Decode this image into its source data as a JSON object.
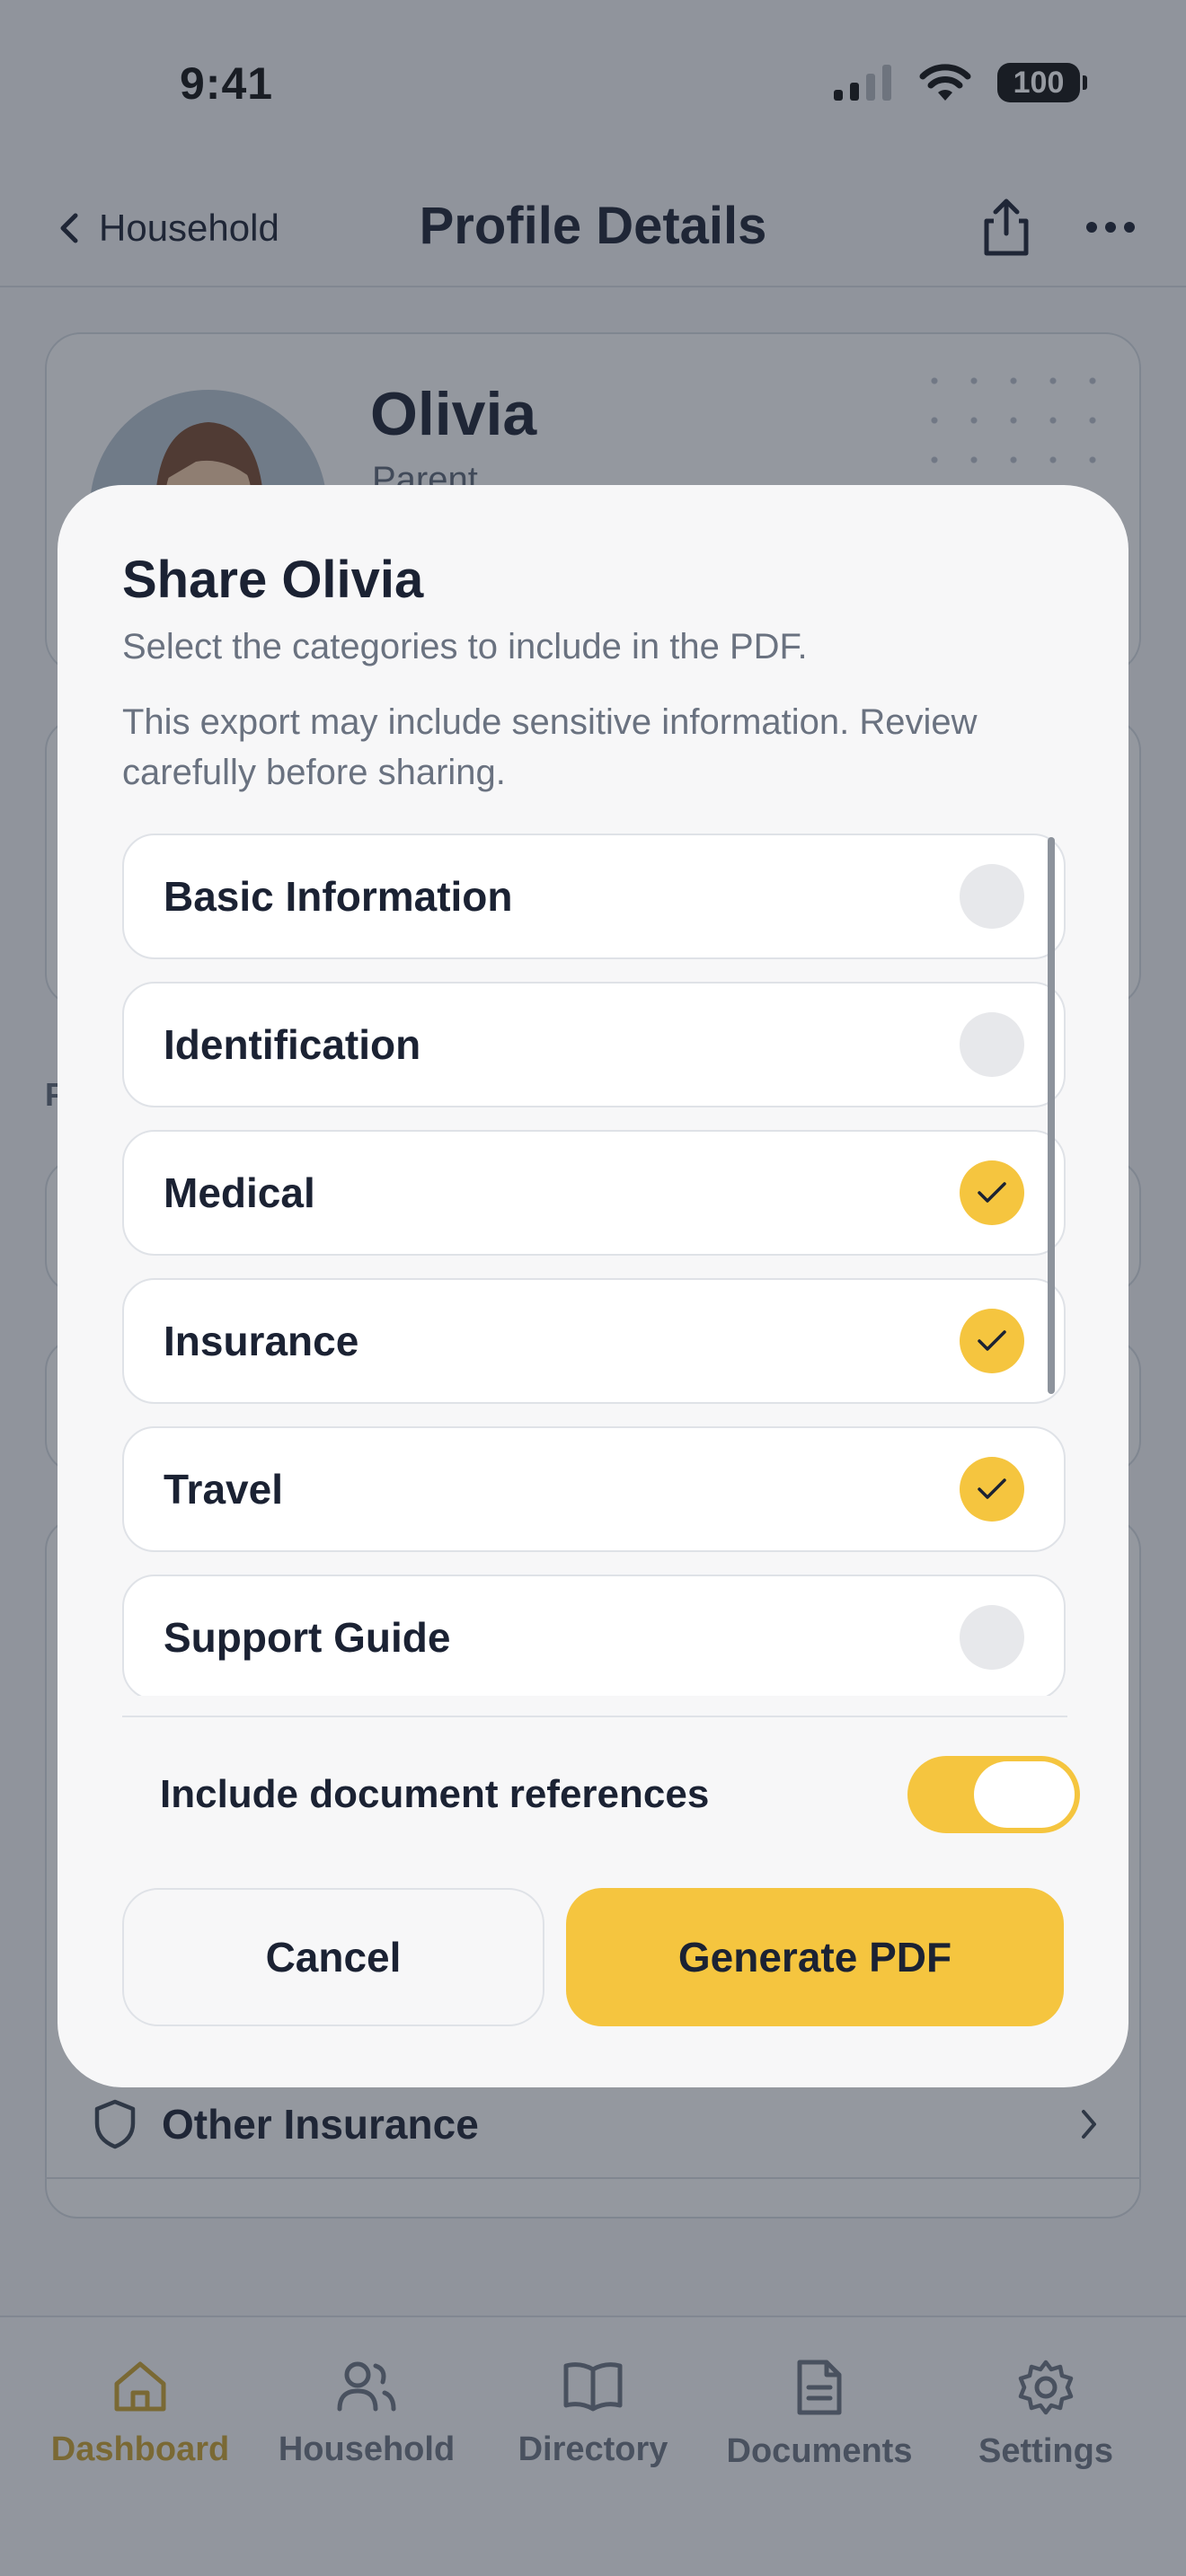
{
  "status_bar": {
    "time": "9:41",
    "battery": "100"
  },
  "nav": {
    "back_label": "Household",
    "title": "Profile Details"
  },
  "profile": {
    "name": "Olivia",
    "role": "Parent"
  },
  "background": {
    "section_initial": "F",
    "row_label": "Other Insurance"
  },
  "modal": {
    "title": "Share Olivia",
    "subtitle": "Select the categories to include in the PDF.",
    "warning": "This export may include sensitive information. Review carefully before sharing.",
    "categories": [
      {
        "label": "Basic Information",
        "checked": false
      },
      {
        "label": "Identification",
        "checked": false
      },
      {
        "label": "Medical",
        "checked": true
      },
      {
        "label": "Insurance",
        "checked": true
      },
      {
        "label": "Travel",
        "checked": true
      },
      {
        "label": "Support Guide",
        "checked": false
      }
    ],
    "toggle_label": "Include document references",
    "toggle_on": true,
    "cancel_label": "Cancel",
    "generate_label": "Generate PDF"
  },
  "tabs": [
    {
      "label": "Dashboard",
      "icon": "home-icon",
      "active": true
    },
    {
      "label": "Household",
      "icon": "people-icon",
      "active": false
    },
    {
      "label": "Directory",
      "icon": "book-icon",
      "active": false
    },
    {
      "label": "Documents",
      "icon": "document-icon",
      "active": false
    },
    {
      "label": "Settings",
      "icon": "gear-icon",
      "active": false
    }
  ],
  "colors": {
    "accent": "#f5c53f",
    "text": "#1b2233",
    "muted": "#6a7280"
  }
}
